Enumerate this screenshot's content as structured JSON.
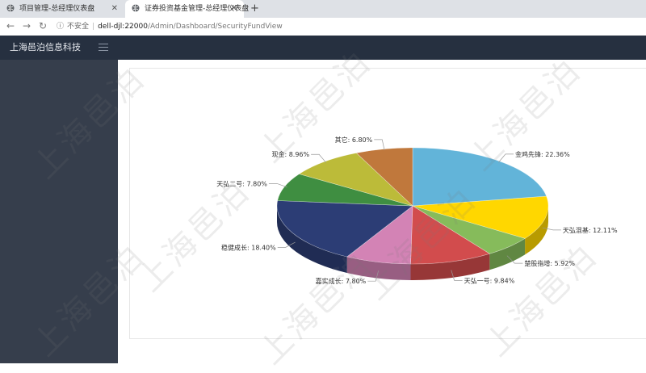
{
  "browser": {
    "tabs": [
      {
        "title": "项目管理-总经理仪表盘",
        "active": false
      },
      {
        "title": "证券投资基金管理-总经理仪表盘",
        "active": true
      }
    ],
    "new_tab_symbol": "+",
    "address": {
      "security_label": "不安全",
      "host": "dell-djl:22000",
      "path": "/Admin/Dashboard/SecurityFundView"
    }
  },
  "app": {
    "brand": "上海邑泊信息科技"
  },
  "watermark": "上海邑泊",
  "chart_data": {
    "type": "pie",
    "style": "3d",
    "slices": [
      {
        "label": "金鸡先锋",
        "value": 22.36,
        "display": "22.36%",
        "color": "#62b4d9"
      },
      {
        "label": "天弘混基",
        "value": 12.11,
        "display": "12.11%",
        "color": "#ffd700"
      },
      {
        "label": "楚股指增",
        "value": 5.92,
        "display": "5.92%",
        "color": "#86bb5b"
      },
      {
        "label": "天弘一号",
        "value": 9.84,
        "display": "9.84%",
        "color": "#d24c4d"
      },
      {
        "label": "嘉实成长",
        "value": 7.8,
        "display": "7.80%",
        "color": "#d383b5"
      },
      {
        "label": "稳健成长",
        "value": 18.4,
        "display": "18.40%",
        "color": "#2c3d75"
      },
      {
        "label": "天弘二号",
        "value": 7.8,
        "display": "7.80%",
        "color": "#3f8e41"
      },
      {
        "label": "现金",
        "value": 8.96,
        "display": "8.96%",
        "color": "#bcbb39"
      },
      {
        "label": "其它",
        "value": 6.8,
        "display": "6.80%",
        "color": "#c0783c"
      }
    ]
  }
}
